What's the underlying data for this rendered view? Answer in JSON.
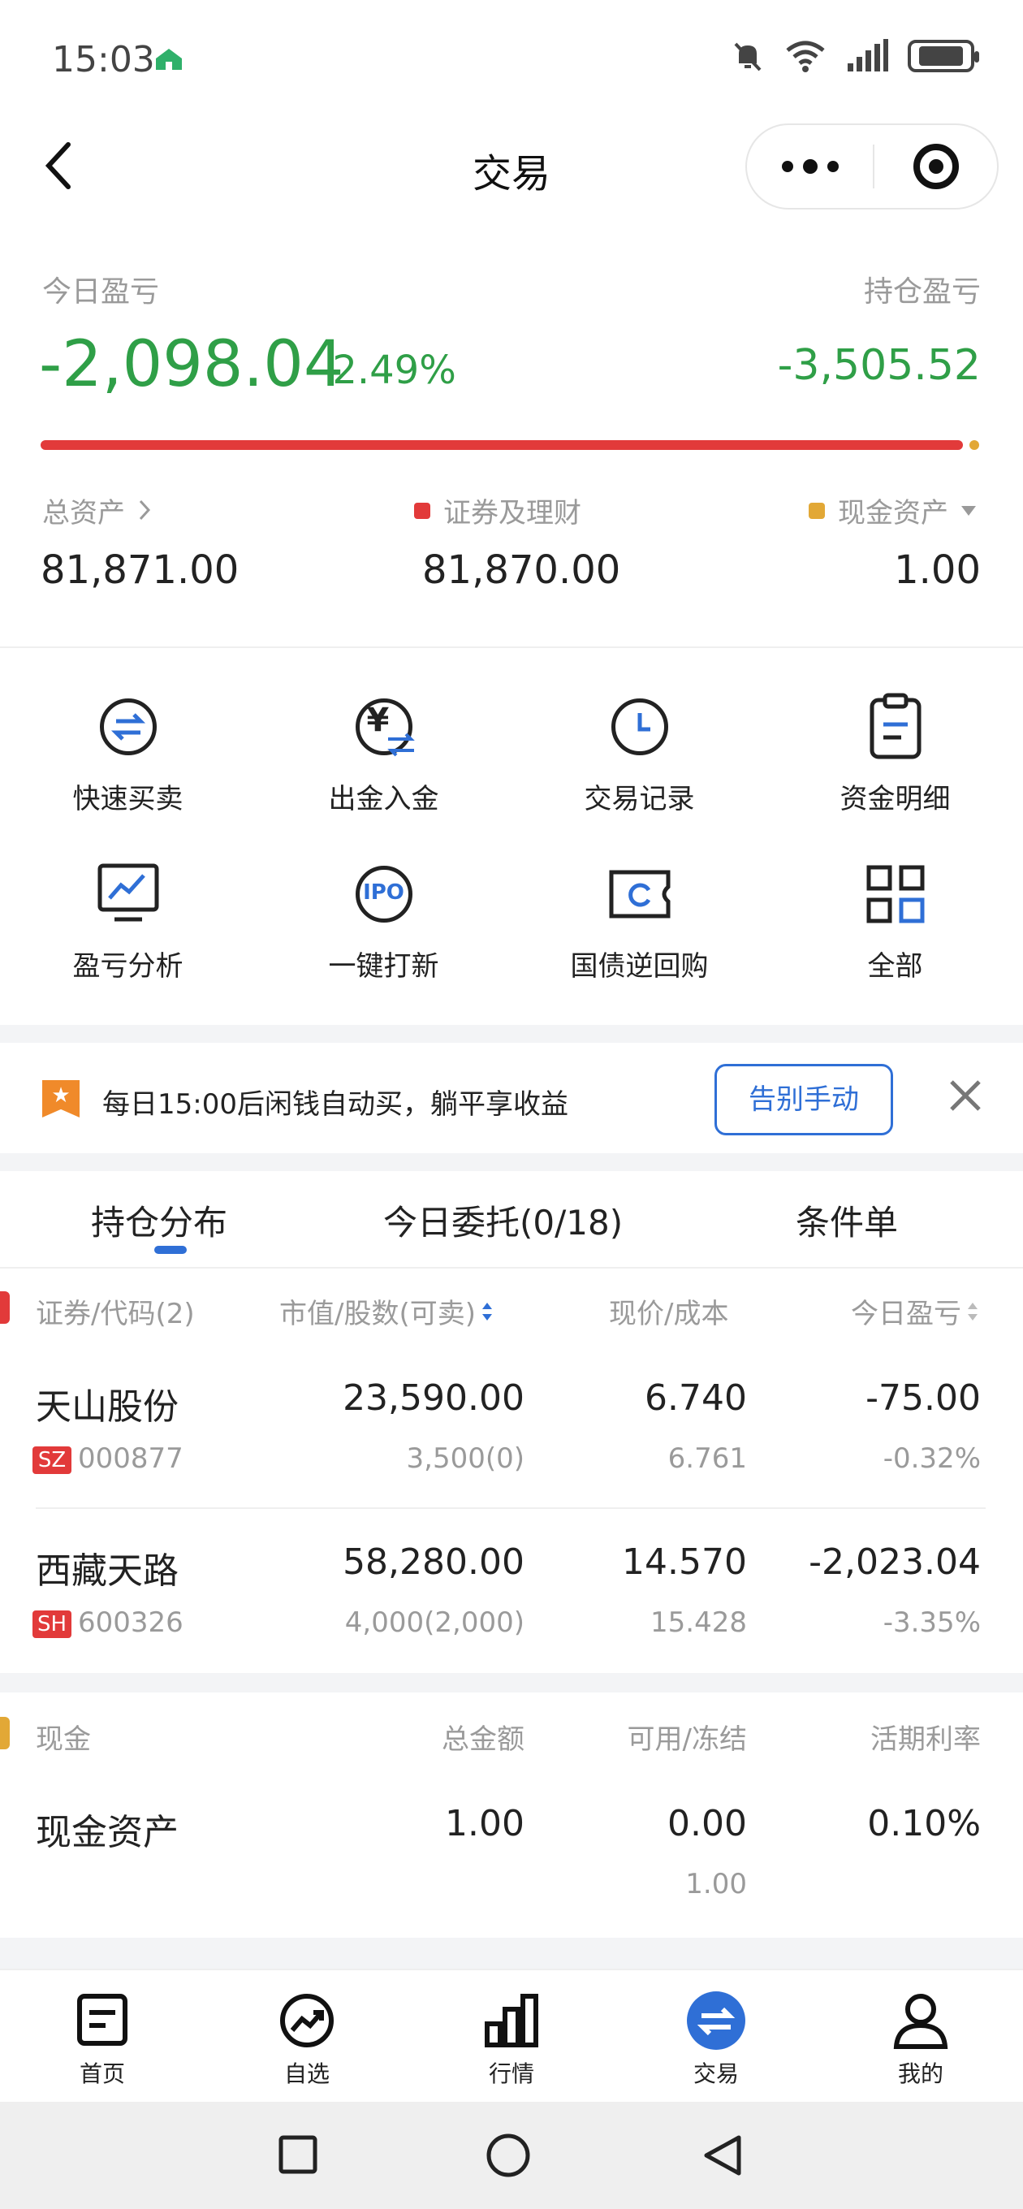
{
  "status_bar": {
    "time": "15:03"
  },
  "header": {
    "title": "交易"
  },
  "summary": {
    "today_pl_label": "今日盈亏",
    "today_pl_value": "-2,098.04",
    "today_pl_percent": "-2.49%",
    "holding_pl_label": "持仓盈亏",
    "holding_pl_value": "-3,505.52",
    "asset_split": {
      "securities_fraction": 0.99998
    },
    "total_asset_label": "总资产",
    "securities_label": "证券及理财",
    "cash_asset_label": "现金资产",
    "total_asset_value": "81,871.00",
    "securities_value": "81,870.00",
    "cash_asset_value": "1.00",
    "colors": {
      "securities": "#e23a3a",
      "cash": "#e2a836",
      "loss": "#2f9f47"
    }
  },
  "functions": [
    {
      "label": "快速买卖",
      "icon": "swap-arrows-icon"
    },
    {
      "label": "出金入金",
      "icon": "yuan-transfer-icon"
    },
    {
      "label": "交易记录",
      "icon": "clock-icon"
    },
    {
      "label": "资金明细",
      "icon": "clipboard-icon"
    },
    {
      "label": "盈亏分析",
      "icon": "chart-monitor-icon"
    },
    {
      "label": "一键打新",
      "icon": "ipo-icon"
    },
    {
      "label": "国债逆回购",
      "icon": "ticket-refresh-icon"
    },
    {
      "label": "全部",
      "icon": "grid-icon"
    }
  ],
  "promo": {
    "text": "每日15:00后闲钱自动买，躺平享收益",
    "button": "告别手动"
  },
  "tabs": [
    "持仓分布",
    "今日委托(0/18)",
    "条件单"
  ],
  "holdings": {
    "headers": [
      "证券/代码(2)",
      "市值/股数(可卖)",
      "现价/成本",
      "今日盈亏"
    ],
    "rows": [
      {
        "name": "天山股份",
        "market": "SZ",
        "code": "000877",
        "market_value": "23,590.00",
        "shares": "3,500(0)",
        "price": "6.740",
        "cost": "6.761",
        "pl": "-75.00",
        "pl_pct": "-0.32%"
      },
      {
        "name": "西藏天路",
        "market": "SH",
        "code": "600326",
        "market_value": "58,280.00",
        "shares": "4,000(2,000)",
        "price": "14.570",
        "cost": "15.428",
        "pl": "-2,023.04",
        "pl_pct": "-3.35%"
      }
    ]
  },
  "cash": {
    "headers": [
      "现金",
      "总金额",
      "可用/冻结",
      "活期利率"
    ],
    "row": {
      "name": "现金资产",
      "total": "1.00",
      "available": "0.00",
      "frozen": "1.00",
      "rate": "0.10%"
    }
  },
  "bottom_nav": [
    {
      "label": "首页",
      "icon": "home-doc-icon"
    },
    {
      "label": "自选",
      "icon": "trend-circle-icon"
    },
    {
      "label": "行情",
      "icon": "bar-chart-icon"
    },
    {
      "label": "交易",
      "icon": "trade-swap-icon",
      "active": true
    },
    {
      "label": "我的",
      "icon": "user-icon"
    }
  ]
}
